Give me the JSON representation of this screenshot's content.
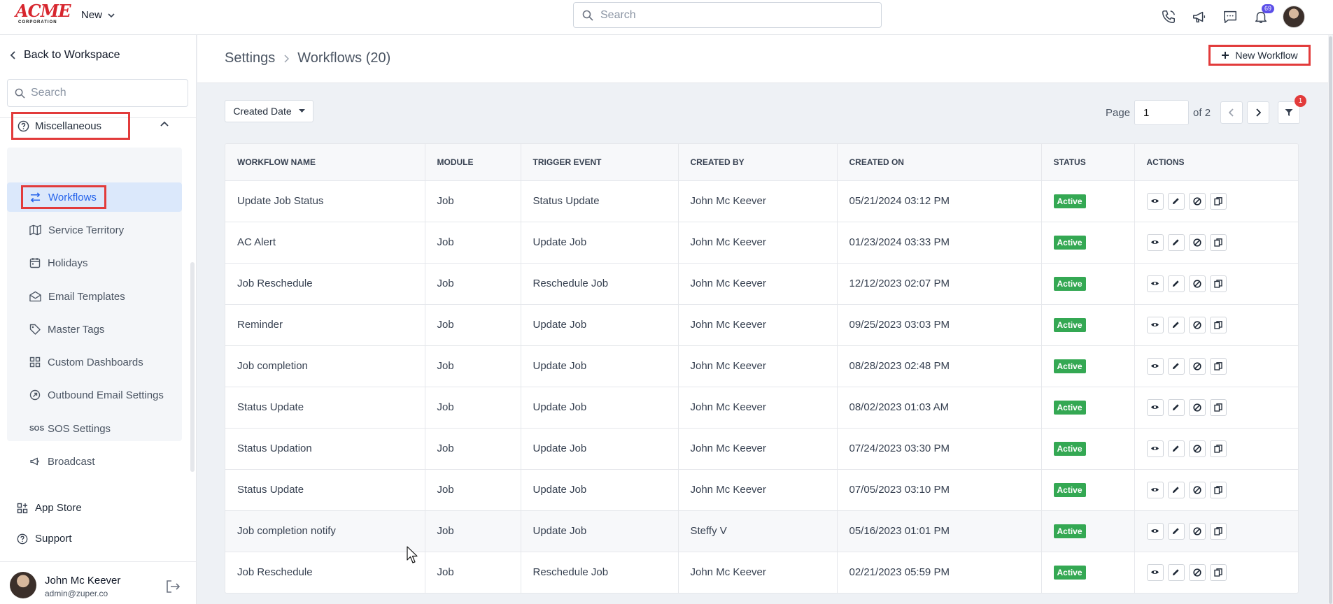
{
  "topbar": {
    "logo_text": "ACME",
    "logo_sub": "CORPORATION",
    "new_label": "New",
    "search_placeholder": "Search",
    "notification_count": "69"
  },
  "sidebar": {
    "back_label": "Back to Workspace",
    "search_placeholder": "Search",
    "section_label": "Miscellaneous",
    "items": [
      {
        "label": "Workflows",
        "icon": "workflow-arrows-icon",
        "active": true
      },
      {
        "label": "Service Territory",
        "icon": "map-icon"
      },
      {
        "label": "Holidays",
        "icon": "calendar-icon"
      },
      {
        "label": "Email Templates",
        "icon": "envelope-open-icon"
      },
      {
        "label": "Master Tags",
        "icon": "tag-icon"
      },
      {
        "label": "Custom Dashboards",
        "icon": "dashboard-grid-icon"
      },
      {
        "label": "Outbound Email Settings",
        "icon": "outbound-circle-icon"
      },
      {
        "label": "SOS Settings",
        "icon": "sos-icon"
      },
      {
        "label": "Broadcast",
        "icon": "megaphone-icon"
      }
    ],
    "app_store_label": "App Store",
    "support_label": "Support",
    "user": {
      "name": "John Mc Keever",
      "email": "admin@zuper.co"
    }
  },
  "header": {
    "breadcrumb_root": "Settings",
    "breadcrumb_current": "Workflows (20)",
    "new_button_label": "New Workflow"
  },
  "toolbar": {
    "sort_label": "Created Date",
    "page_label": "Page",
    "page_value": "1",
    "page_of": "of 2",
    "filter_count": "1"
  },
  "table": {
    "columns": [
      "WORKFLOW NAME",
      "MODULE",
      "TRIGGER EVENT",
      "CREATED BY",
      "CREATED ON",
      "STATUS",
      "ACTIONS"
    ],
    "rows": [
      {
        "name": "Update Job Status",
        "module": "Job",
        "trigger": "Status Update",
        "created_by": "John Mc Keever",
        "created_on": "05/21/2024 03:12 PM",
        "status": "Active"
      },
      {
        "name": "AC Alert",
        "module": "Job",
        "trigger": "Update Job",
        "created_by": "John Mc Keever",
        "created_on": "01/23/2024 03:33 PM",
        "status": "Active"
      },
      {
        "name": "Job Reschedule",
        "module": "Job",
        "trigger": "Reschedule Job",
        "created_by": "John Mc Keever",
        "created_on": "12/12/2023 02:07 PM",
        "status": "Active"
      },
      {
        "name": "Reminder",
        "module": "Job",
        "trigger": "Update Job",
        "created_by": "John Mc Keever",
        "created_on": "09/25/2023 03:03 PM",
        "status": "Active"
      },
      {
        "name": "Job completion",
        "module": "Job",
        "trigger": "Update Job",
        "created_by": "John Mc Keever",
        "created_on": "08/28/2023 02:48 PM",
        "status": "Active"
      },
      {
        "name": "Status Update",
        "module": "Job",
        "trigger": "Update Job",
        "created_by": "John Mc Keever",
        "created_on": "08/02/2023 01:03 AM",
        "status": "Active"
      },
      {
        "name": "Status Updation",
        "module": "Job",
        "trigger": "Update Job",
        "created_by": "John Mc Keever",
        "created_on": "07/24/2023 03:30 PM",
        "status": "Active"
      },
      {
        "name": "Status Update",
        "module": "Job",
        "trigger": "Update Job",
        "created_by": "John Mc Keever",
        "created_on": "07/05/2023 03:10 PM",
        "status": "Active"
      },
      {
        "name": "Job completion notify",
        "module": "Job",
        "trigger": "Update Job",
        "created_by": "Steffy V",
        "created_on": "05/16/2023 01:01 PM",
        "status": "Active",
        "hovered": true
      },
      {
        "name": "Job Reschedule",
        "module": "Job",
        "trigger": "Reschedule Job",
        "created_by": "John Mc Keever",
        "created_on": "02/21/2023 05:59 PM",
        "status": "Active"
      }
    ]
  },
  "colors": {
    "accent": "#2563eb",
    "highlight": "#e23b3b",
    "status_active": "#34a853"
  }
}
